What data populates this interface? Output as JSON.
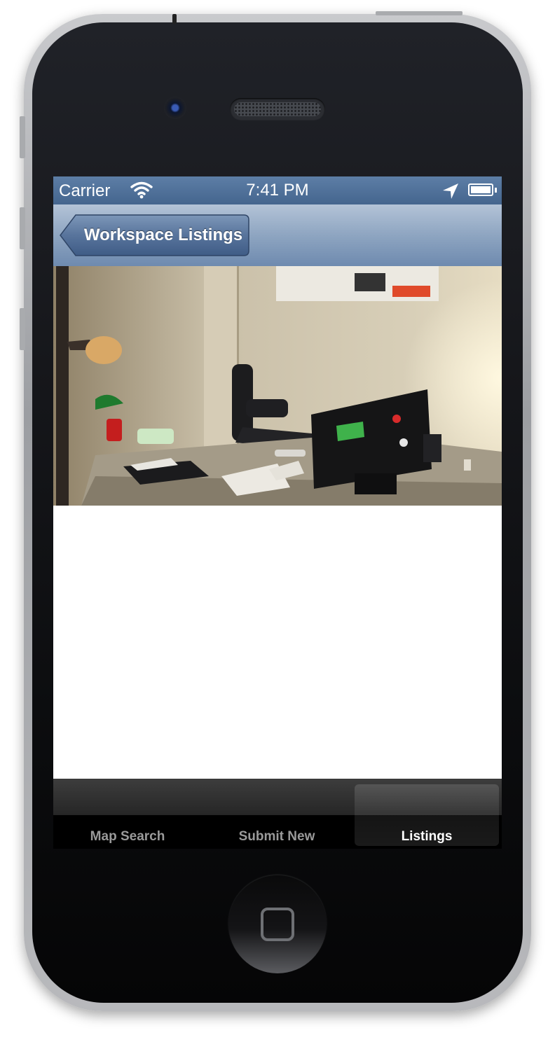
{
  "status_bar": {
    "carrier": "Carrier",
    "time": "7:41 PM"
  },
  "nav_bar": {
    "back_label": "Workspace Listings"
  },
  "tab_bar": {
    "tabs": [
      {
        "label": "Map Search",
        "selected": false
      },
      {
        "label": "Submit New",
        "selected": false
      },
      {
        "label": "Listings",
        "selected": true
      }
    ]
  },
  "colors": {
    "status_bar": "#4f7099",
    "nav_bar": "#8ea5c1",
    "tab_bar": "#000000",
    "tab_selected_text": "#ffffff",
    "tab_text": "#9a9a9a"
  }
}
